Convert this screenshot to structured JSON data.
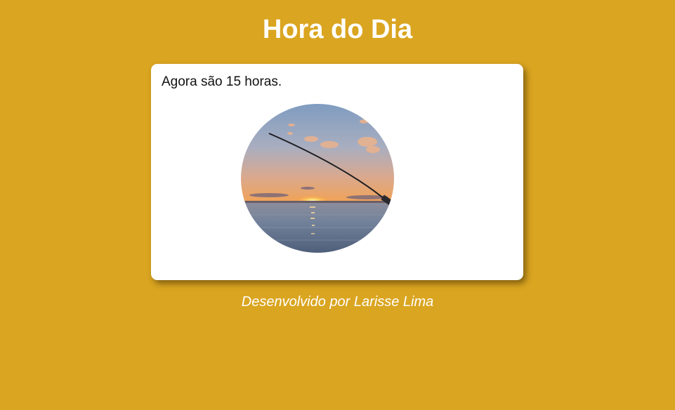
{
  "page": {
    "title": "Hora do Dia",
    "background_color": "#DAA520"
  },
  "card": {
    "message": "Agora são 15 horas.",
    "image": {
      "icon": "sunset-fishing-photo",
      "description_colors": {
        "sky_top": "#8EA9C8",
        "horizon": "#F29A3E",
        "sea": "#6E7F97"
      }
    }
  },
  "footer": {
    "credit": "Desenvolvido por Larisse Lima"
  }
}
